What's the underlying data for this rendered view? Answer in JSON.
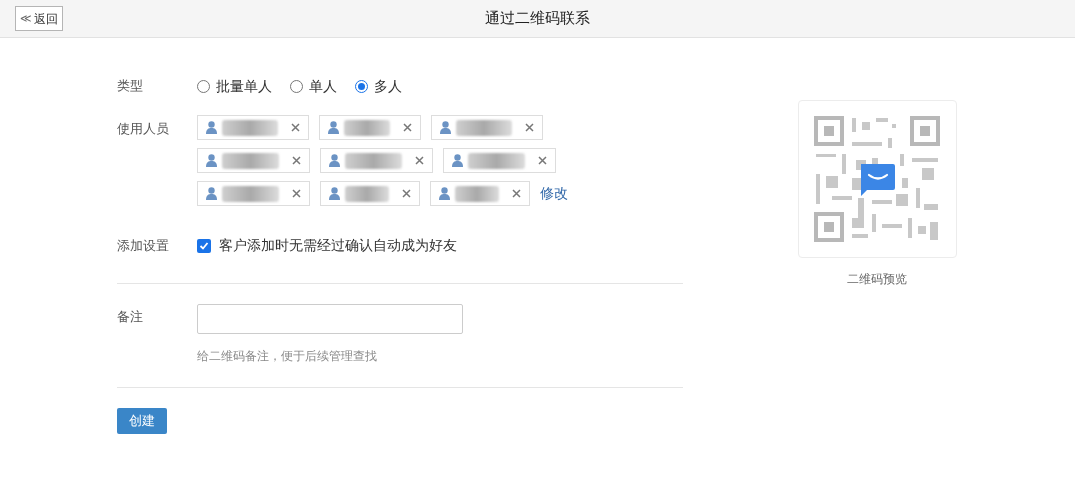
{
  "header": {
    "back_button": {
      "icon": "≪",
      "label": "返回"
    },
    "title": "通过二维码联系"
  },
  "type_row": {
    "label": "类型",
    "options": [
      {
        "label": "批量单人",
        "selected": false
      },
      {
        "label": "单人",
        "selected": false
      },
      {
        "label": "多人",
        "selected": true
      }
    ]
  },
  "members_row": {
    "label": "使用人员",
    "members": [
      {
        "kind": "blurred"
      },
      {
        "kind": "blurred"
      },
      {
        "kind": "blurred"
      },
      {
        "kind": "blurred"
      },
      {
        "kind": "blurred"
      },
      {
        "kind": "blurred"
      },
      {
        "kind": "blurred"
      },
      {
        "kind": "blurred"
      },
      {
        "kind": "blurred"
      }
    ],
    "edit_link": "修改"
  },
  "setting_row": {
    "label": "添加设置",
    "checkbox": {
      "label": "客户添加时无需经过确认自动成为好友",
      "checked": true
    }
  },
  "note_row": {
    "label": "备注",
    "hint": "给二维码备注，便于后续管理查找"
  },
  "create_button": "创建",
  "qr_preview": {
    "caption": "二维码预览"
  }
}
